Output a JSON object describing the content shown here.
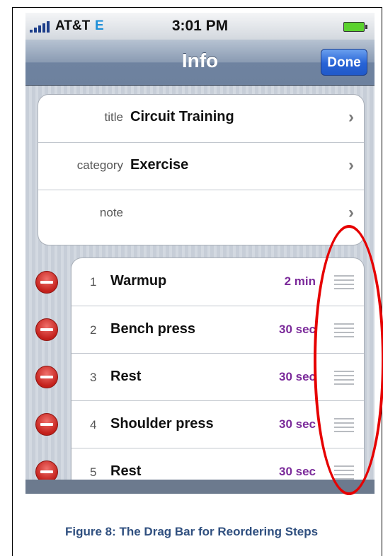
{
  "status_bar": {
    "carrier": "AT&T",
    "network": "E",
    "time": "3:01 PM"
  },
  "nav": {
    "title": "Info",
    "done_label": "Done"
  },
  "details": [
    {
      "label": "title",
      "value": "Circuit Training"
    },
    {
      "label": "category",
      "value": "Exercise"
    },
    {
      "label": "note",
      "value": ""
    }
  ],
  "steps": [
    {
      "num": "1",
      "name": "Warmup",
      "duration": "2 min"
    },
    {
      "num": "2",
      "name": "Bench press",
      "duration": "30 sec"
    },
    {
      "num": "3",
      "name": "Rest",
      "duration": "30 sec"
    },
    {
      "num": "4",
      "name": "Shoulder press",
      "duration": "30 sec"
    },
    {
      "num": "5",
      "name": "Rest",
      "duration": "30 sec"
    }
  ],
  "caption": "Figure 8:  The Drag Bar for Reordering Steps",
  "colors": {
    "delete": "#c3201b",
    "duration": "#7b2a9a",
    "annotation": "#e60000",
    "done_button": "#2763d6"
  }
}
